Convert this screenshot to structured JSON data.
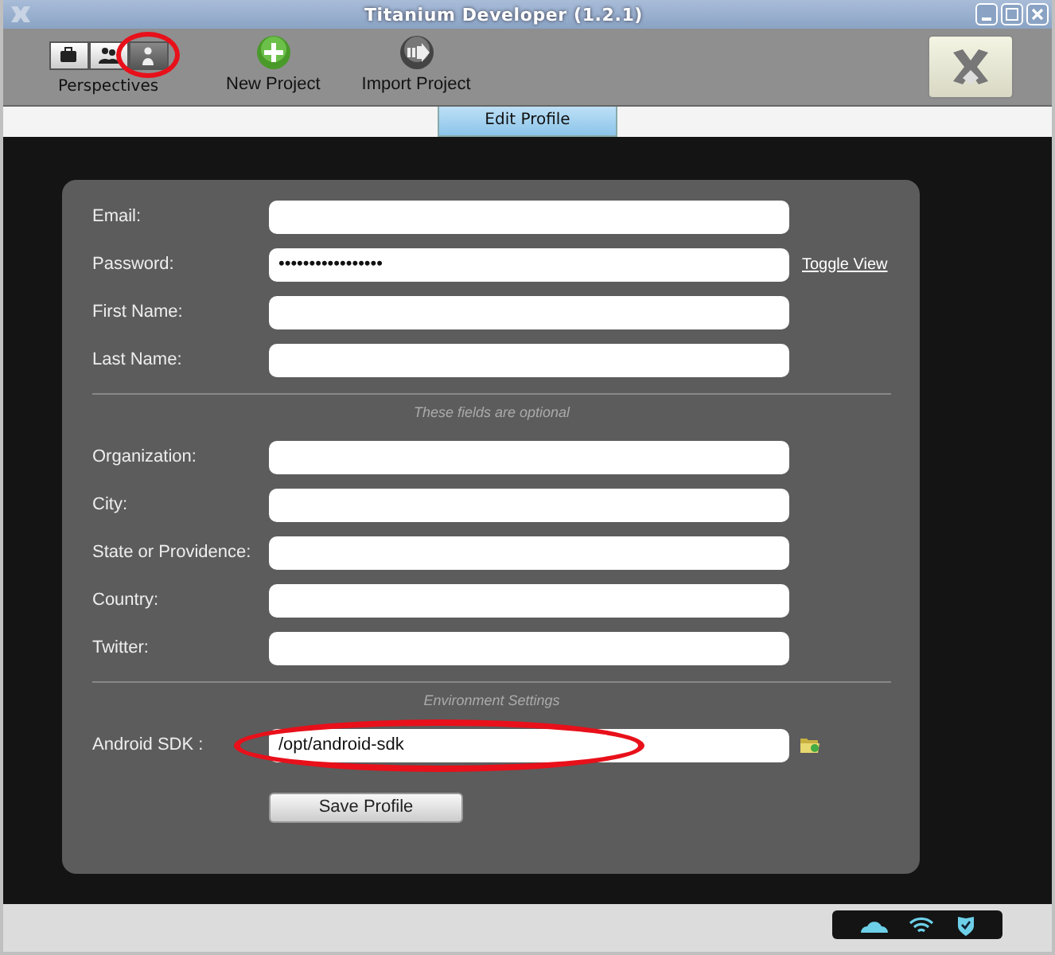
{
  "window": {
    "title": "Titanium Developer (1.2.1)"
  },
  "perspectives": {
    "label": "Perspectives",
    "buttons": [
      {
        "kind": "briefcase",
        "selected": false
      },
      {
        "kind": "people",
        "selected": false
      },
      {
        "kind": "person",
        "selected": true
      }
    ]
  },
  "actions": [
    {
      "kind": "add",
      "label": "New Project"
    },
    {
      "kind": "import",
      "label": "Import Project"
    }
  ],
  "tabs": [
    {
      "label": "Edit Profile",
      "selected": true
    }
  ],
  "form": {
    "sections": [
      {
        "fields": [
          {
            "label": "Email:"
          },
          {
            "label": "Password:",
            "value": "•••••••••••••••••",
            "link": "Toggle View"
          },
          {
            "label": "First Name:"
          },
          {
            "label": "Last Name:"
          }
        ]
      },
      {
        "heading": "These fields are optional",
        "fields": [
          {
            "label": "Organization:"
          },
          {
            "label": "City:"
          },
          {
            "label": "State or Providence:"
          },
          {
            "label": "Country:"
          },
          {
            "label": "Twitter:"
          }
        ]
      },
      {
        "heading": "Environment Settings",
        "fields": [
          {
            "label": "Android SDK :",
            "value": "/opt/android-sdk",
            "browse": true,
            "highlighted": true
          }
        ]
      }
    ],
    "save": "Save Profile"
  }
}
